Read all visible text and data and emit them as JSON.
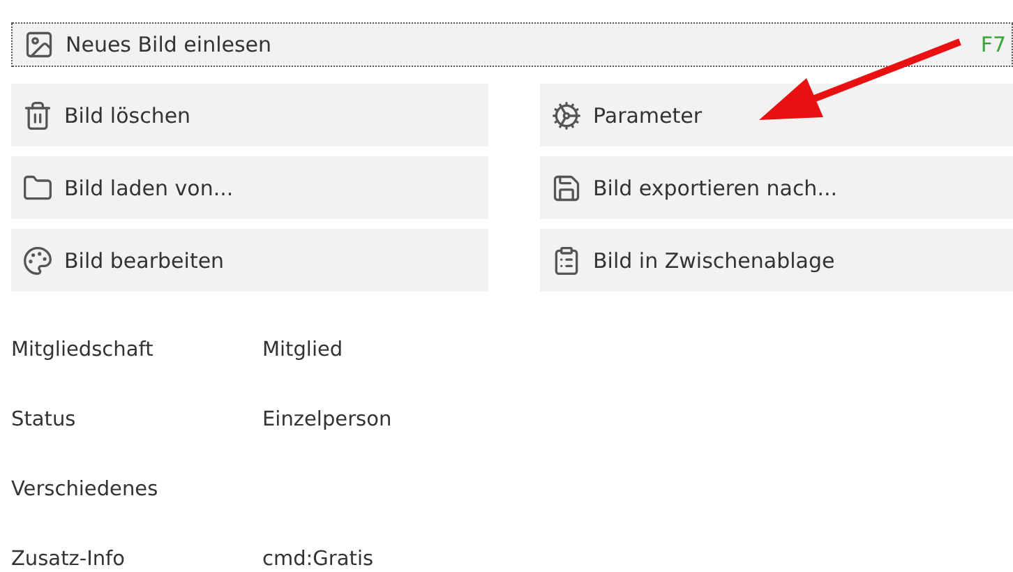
{
  "main_action": {
    "label": "Neues Bild einlesen",
    "shortcut": "F7",
    "focused": true
  },
  "actions": [
    {
      "label": "Bild löschen"
    },
    {
      "label": "Parameter"
    },
    {
      "label": "Bild laden von..."
    },
    {
      "label": "Bild exportieren nach..."
    },
    {
      "label": "Bild bearbeiten"
    },
    {
      "label": "Bild in Zwischenablage"
    }
  ],
  "info": [
    {
      "label": "Mitgliedschaft",
      "value": "Mitglied"
    },
    {
      "label": "Status",
      "value": "Einzelperson"
    },
    {
      "label": "Verschiedenes"
    },
    {
      "label": "Zusatz-Info",
      "value": "cmd:Gratis"
    }
  ],
  "annotation": {
    "kind": "arrow"
  }
}
